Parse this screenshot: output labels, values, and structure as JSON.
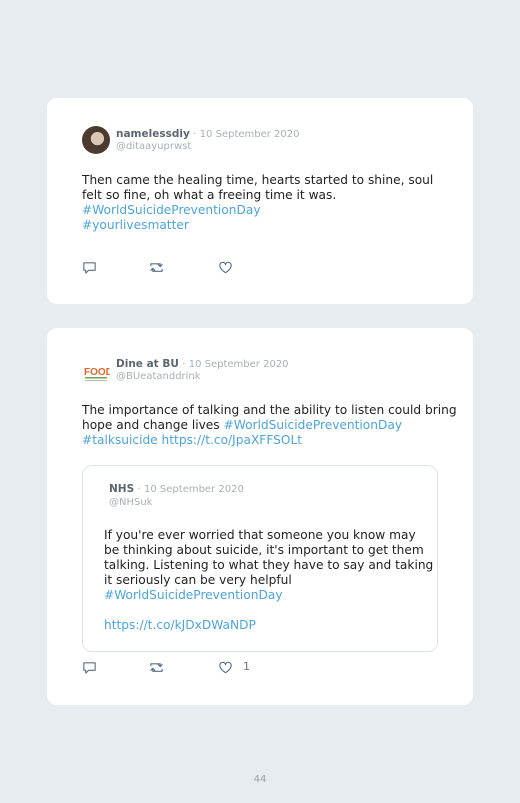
{
  "tweets": [
    {
      "name": "namelessdiy",
      "date": "10 September 2020",
      "handle": "@ditaayuprwst",
      "lines": [
        {
          "text": "Then came the healing time, hearts started to shine, soul"
        },
        {
          "text": "felt so fine, oh what a freeing time it was."
        },
        {
          "link": "#WorldSuicidePreventionDay"
        },
        {
          "link": "#yourlivesmatter"
        }
      ]
    },
    {
      "name": "Dine at BU",
      "date": "10 September 2020",
      "handle": "@BUeatanddrink",
      "avatar_text": "FOOD",
      "line1": "The importance of talking and the ability to listen could bring",
      "line2_text": "hope and change lives ",
      "line2_link": "#WorldSuicidePreventionDay",
      "line3_link": "#talksuicide https://t.co/JpaXFFSOLt",
      "like_count": "1",
      "quote": {
        "name": "NHS",
        "date": "10 September 2020",
        "handle": "@NHSuk",
        "lines": [
          "If you're ever worried that someone you know may",
          "be thinking about suicide, it's important to get them",
          "talking. Listening to what they have to say and taking",
          "it seriously can be very helpful"
        ],
        "hashtag": "#WorldSuicidePreventionDay",
        "url": "https://t.co/kJDxDWaNDP"
      }
    }
  ],
  "page_number": "44",
  "colors": {
    "link": "#4ea3d4",
    "background": "#e6ecef",
    "card": "#ffffff"
  },
  "icons": [
    "reply-icon",
    "retweet-icon",
    "like-icon"
  ]
}
